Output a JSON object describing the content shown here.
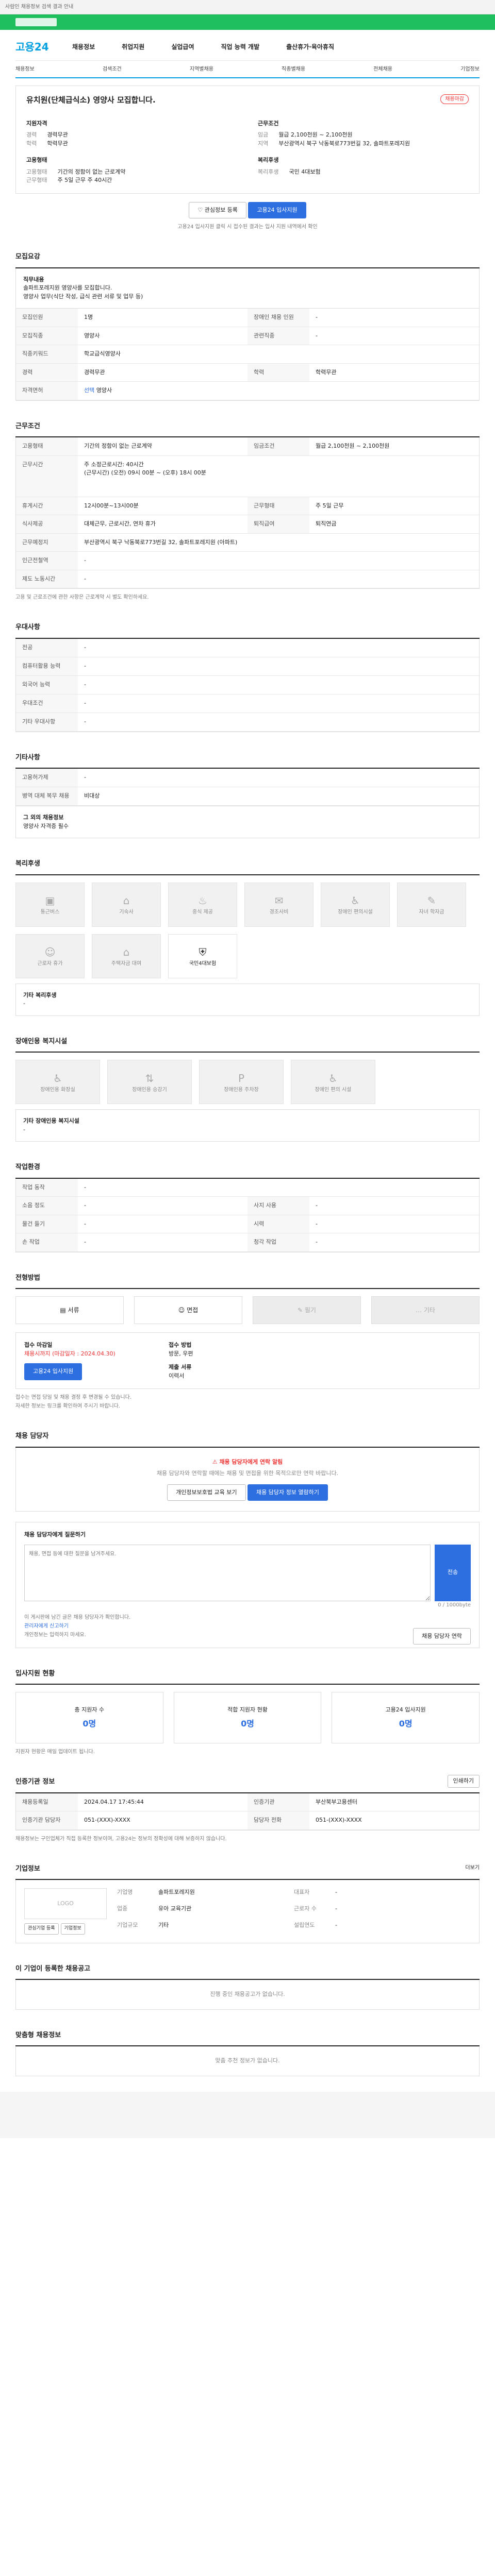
{
  "topbar": "사람인 채용정보 검색 결과 안내",
  "logo": "고용24",
  "gnb": [
    "채용정보",
    "취업지원",
    "실업급여",
    "직업 능력 개발",
    "출산휴가·육아휴직"
  ],
  "subnav": [
    "채용정보",
    "검색조건",
    "지역별채용",
    "직종별채용",
    "전체채용",
    "기업정보"
  ],
  "job": {
    "title": "유치원(단체급식소) 영양사 모집합니다.",
    "badge": "채용마감",
    "apply": "고용24 입사지원",
    "scrap": "관심정보 등록",
    "left_h": "지원자격",
    "left": [
      [
        "경력",
        "경력무관"
      ],
      [
        "학력",
        "학력무관"
      ]
    ],
    "left_h2": "고용형태",
    "left2": [
      [
        "고용형태",
        "기간의 정함이 없는 근로계약"
      ],
      [
        "근무형태",
        "주 5일 근무 주 40시간"
      ]
    ],
    "right_h": "근무조건",
    "right": [
      [
        "임금",
        "월급 2,100천원 ~ 2,100천원"
      ],
      [
        "지역",
        "부산광역시 북구 낙동북로773번길 32, 솔파트포레지원"
      ]
    ],
    "right_h2": "복리후생",
    "right2": [
      [
        "복리후생",
        "국민 4대보험"
      ]
    ],
    "notice": "고용24 입사지원 클릭 시 접수된 결과는 입사 지원 내역에서 확인"
  },
  "recruit": {
    "title": "모집요강",
    "sub_h": "직무내용",
    "desc": [
      "솔파트포레지원 영양사를 모집합니다.",
      "영양사 업무(식단 작성, 급식 관련 서류 및 업무 등)"
    ],
    "rows": [
      [
        "모집인원",
        "1명",
        "장애인 채용 인원",
        "-"
      ],
      [
        "모집직종",
        "영양사",
        "관련직종",
        "-"
      ],
      [
        "직종키워드",
        "학교급식영양사",
        ""
      ],
      [
        "경력",
        "경력무관",
        "학력",
        "학력무관"
      ],
      [
        "자격면허",
        "선택",
        "영양사",
        ""
      ]
    ]
  },
  "cond": {
    "title": "근무조건",
    "rows": [
      [
        "고용형태",
        "기간의 정함이 없는 근로계약",
        "임금조건",
        "월급 2,100천원 ~ 2,100천원"
      ],
      [
        "근무시간",
        "주 소정근로시간: 40시간\n(근무시간) (오전) 09시 00분 ~ (오후) 18시 00분",
        "",
        ""
      ],
      [
        "휴게시간",
        "12시00분~13시00분",
        "근무형태",
        "주 5일 근무"
      ],
      [
        "식사제공",
        "대체근무, 근로시간, 연차 휴가",
        "퇴직급여",
        "퇴직연금"
      ],
      [
        "근무예정지",
        "부산광역시 북구 낙동북로773번길 32, 솔파트포레지원 (아파트)",
        "",
        ""
      ],
      [
        "인근전철역",
        "-",
        "",
        ""
      ],
      [
        "제도 노동시간",
        "-",
        "",
        ""
      ]
    ],
    "note": "고용 및 근로조건에 관한 사항은 근로계약 시 별도 확인하세요."
  },
  "pref": {
    "title": "우대사항",
    "rows": [
      [
        "전공",
        "-"
      ],
      [
        "컴퓨터활용 능력",
        "-"
      ],
      [
        "외국어 능력",
        "-"
      ],
      [
        "우대조건",
        "-"
      ],
      [
        "기타 우대사항",
        "-"
      ]
    ]
  },
  "other": {
    "title": "기타사항",
    "rows": [
      [
        "고용허가제",
        "-"
      ],
      [
        "병역 대체 복무 채용",
        "비대상"
      ]
    ],
    "extra_h": "그 외의 채용정보",
    "extra": "영양사 자격증 필수"
  },
  "welfare": {
    "title": "복리후생",
    "items": [
      [
        "bus-icon",
        "통근버스"
      ],
      [
        "car-icon",
        "기숙사"
      ],
      [
        "meal-icon",
        "중식 제공"
      ],
      [
        "gift-icon",
        "경조사비"
      ],
      [
        "wheel-icon",
        "장애인 편의시설"
      ],
      [
        "cap-icon",
        "자녀 학자금"
      ],
      [
        "child-icon",
        "근로자 휴가"
      ],
      [
        "office-icon",
        "주택자금 대여"
      ],
      [
        "shield-icon",
        "국민4대보험"
      ]
    ],
    "active": "국민4대보험",
    "other_h": "기타 복리후생",
    "other": "-"
  },
  "disability": {
    "title": "장애인용 복지시설",
    "items": [
      "장애인용 화장실",
      "장애인용 승강기",
      "장애인용 주차장",
      "장애인 편의 시설"
    ],
    "other_h": "기타 장애인용 복지시설",
    "other": "-"
  },
  "workenv": {
    "title": "작업환경",
    "rows": [
      [
        "작업 동작",
        "-",
        "",
        ""
      ],
      [
        "소음 정도",
        "-",
        "사지 사용",
        "-"
      ],
      [
        "물건 들기",
        "-",
        "시력",
        "-"
      ],
      [
        "손 작업",
        "-",
        "청각 작업",
        "-"
      ]
    ]
  },
  "apply": {
    "title": "전형방법",
    "methods": [
      "서류",
      "면접",
      "필기",
      "기타"
    ],
    "deadline_h": "접수 마감일",
    "deadline": "채용시까지 (마감일자 : 2024.04.30)",
    "deadline_btn": "고용24 입사지원",
    "how_h": "접수 방법",
    "how": "방문, 우편",
    "docs_h": "제출 서류",
    "docs": "이력서",
    "notes": [
      "접수는 면접 당일 및 채용 결정 후 변경될 수 있습니다.",
      "자세한 정보는 링크를 확인하여 주시기 바랍니다."
    ]
  },
  "contact": {
    "title": "채용 담당자",
    "alert": "채용 담당자에게 연락 알림",
    "alert_sub": "채용 담당자와 연락할 때에는 채용 및 면접을 위한 목적으로만 연락 바랍니다.",
    "btn1": "개인정보보호법 교육 보기",
    "btn2": "채용 담당자 정보 열람하기",
    "q_h": "채용 담당자에게 질문하기",
    "q_ph": "채용, 면접 등에 대한 질문을 남겨주세요.",
    "q_btn": "전송",
    "q_count": "0 / 1000byte",
    "q_notes": [
      "이 게시판에 남긴 글은 채용 담당자가 확인합니다.",
      "관리자에게 신고하기",
      "개인정보는 입력하지 마세요."
    ],
    "q_btn2": "채용 담당자 연락"
  },
  "status": {
    "title": "입사지원 현황",
    "items": [
      [
        "총 지원자 수",
        "0명"
      ],
      [
        "적합 지원자 현황",
        "0명"
      ],
      [
        "고용24 입사지원",
        "0명"
      ]
    ],
    "note": "지원자 현황은 매일 업데이트 됩니다."
  },
  "info": {
    "title": "인증기관 정보",
    "btn": "인쇄하기",
    "rows": [
      [
        "채용등록일",
        "2024.04.17 17:45:44",
        "인증기관",
        "부산북부고용센터"
      ],
      [
        "인증기관 담당자",
        "051-(XXX)-XXXX",
        "담당자 전화",
        "051-(XXX)-XXXX"
      ]
    ],
    "note": "채용정보는 구인업체가 직접 등록한 정보이며, 고용24는 정보의 정확성에 대해 보증하지 않습니다."
  },
  "company": {
    "title": "기업정보",
    "more": "더보기",
    "logo": "LOGO",
    "rows": [
      [
        "기업명",
        "솔파트포레지원",
        "대표자",
        "-"
      ],
      [
        "업종",
        "유아 교육기관",
        "근로자 수",
        "-"
      ],
      [
        "기업규모",
        "기타",
        "설립연도",
        "-"
      ]
    ],
    "btn1": "관심기업 등록",
    "btn2": "기업정보"
  },
  "same": {
    "title": "이 기업이 등록한 채용공고",
    "note": "진행 중인 채용공고가 없습니다."
  },
  "recommend": {
    "title": "맞춤형 채용정보",
    "note": "맞춤 추천 정보가 없습니다."
  }
}
